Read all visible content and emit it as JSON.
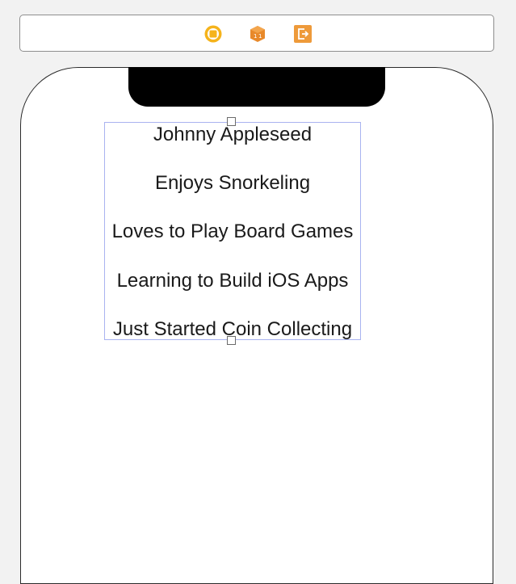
{
  "scene_dock": {
    "icons": [
      "view-controller-icon",
      "first-responder-icon",
      "exit-icon"
    ]
  },
  "stack_view": {
    "labels": [
      "Johnny Appleseed",
      "Enjoys Snorkeling",
      "Loves to Play Board Games",
      "Learning to Build iOS Apps",
      "Just Started Coin Collecting"
    ]
  },
  "colors": {
    "view_controller": "#f5b31b",
    "first_responder": "#e8892a",
    "exit": "#ee9a3a",
    "selection_outline": "#a9b3f0"
  }
}
